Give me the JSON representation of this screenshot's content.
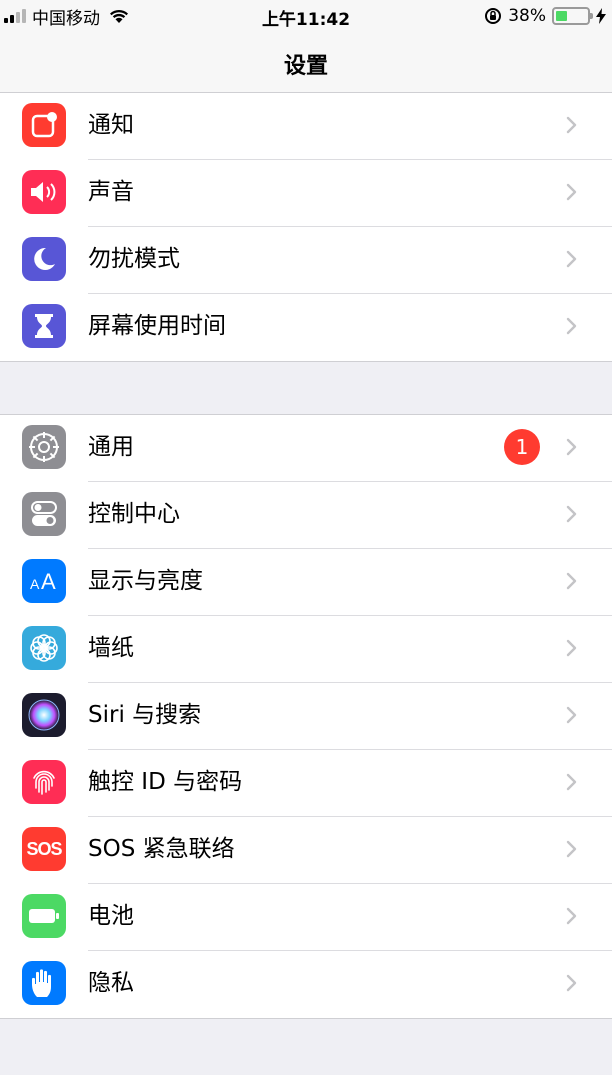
{
  "status_bar": {
    "carrier": "中国移动",
    "time": "上午11:42",
    "battery_percent": "38%",
    "battery_level": 0.38
  },
  "nav": {
    "title": "设置"
  },
  "groups": [
    {
      "rows": [
        {
          "label": "通知",
          "icon": "notifications-icon",
          "color": "#ff3b30"
        },
        {
          "label": "声音",
          "icon": "sound-icon",
          "color": "#ff2d55"
        },
        {
          "label": "勿扰模式",
          "icon": "moon-icon",
          "color": "#5856d6"
        },
        {
          "label": "屏幕使用时间",
          "icon": "hourglass-icon",
          "color": "#5856d6"
        }
      ]
    },
    {
      "rows": [
        {
          "label": "通用",
          "icon": "gear-icon",
          "color": "#8e8e93",
          "badge": "1"
        },
        {
          "label": "控制中心",
          "icon": "toggles-icon",
          "color": "#8e8e93"
        },
        {
          "label": "显示与亮度",
          "icon": "text-size-icon",
          "color": "#007aff"
        },
        {
          "label": "墙纸",
          "icon": "flower-icon",
          "color": "#35aadc"
        },
        {
          "label": "Siri 与搜索",
          "icon": "siri-icon",
          "color": "#1c1c2e"
        },
        {
          "label": "触控 ID 与密码",
          "icon": "fingerprint-icon",
          "color": "#ff2d55"
        },
        {
          "label": "SOS 紧急联络",
          "icon": "sos-icon",
          "color": "#ff3b30",
          "icon_text": "SOS"
        },
        {
          "label": "电池",
          "icon": "battery-icon",
          "color": "#4cd964"
        },
        {
          "label": "隐私",
          "icon": "hand-icon",
          "color": "#007aff"
        }
      ]
    }
  ]
}
